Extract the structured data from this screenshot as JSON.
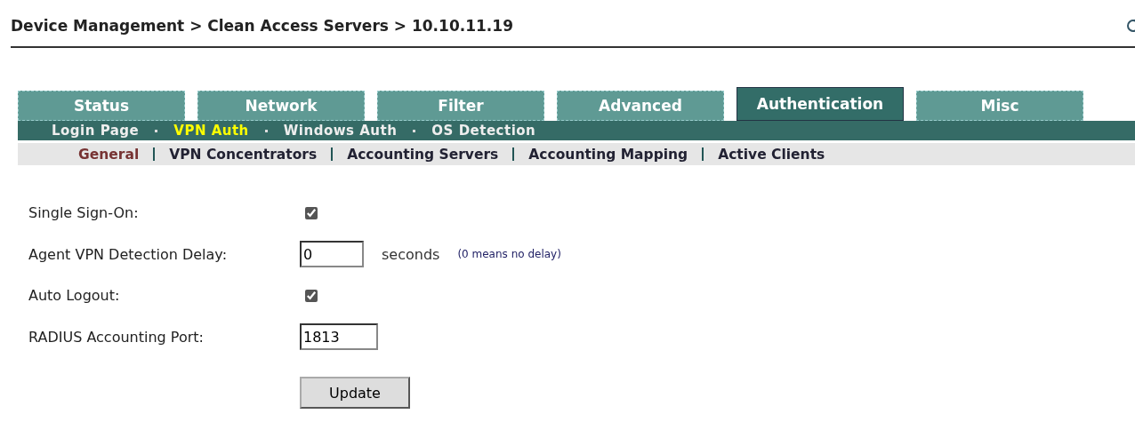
{
  "breadcrumb": "Device Management > Clean Access Servers > 10.10.11.19",
  "tabs": [
    {
      "label": "Status",
      "selected": false
    },
    {
      "label": "Network",
      "selected": false
    },
    {
      "label": "Filter",
      "selected": false
    },
    {
      "label": "Advanced",
      "selected": false
    },
    {
      "label": "Authentication",
      "selected": true
    },
    {
      "label": "Misc",
      "selected": false
    }
  ],
  "subtabs": [
    {
      "label": "Login Page",
      "selected": false
    },
    {
      "label": "VPN Auth",
      "selected": true
    },
    {
      "label": "Windows Auth",
      "selected": false
    },
    {
      "label": "OS Detection",
      "selected": false
    }
  ],
  "subsubtabs": [
    {
      "label": "General",
      "selected": true
    },
    {
      "label": "VPN Concentrators",
      "selected": false
    },
    {
      "label": "Accounting Servers",
      "selected": false
    },
    {
      "label": "Accounting Mapping",
      "selected": false
    },
    {
      "label": "Active Clients",
      "selected": false
    }
  ],
  "fields": [
    {
      "kind": "checkbox",
      "label": "Single Sign-On:",
      "checked": true
    },
    {
      "kind": "text",
      "label": "Agent VPN Detection Delay:",
      "value": "0",
      "unit": "seconds",
      "hint": "(0 means no delay)"
    },
    {
      "kind": "checkbox",
      "label": "Auto Logout:",
      "checked": true
    },
    {
      "kind": "text",
      "label": "RADIUS Accounting Port:",
      "value": "1813"
    }
  ],
  "button": "Update"
}
